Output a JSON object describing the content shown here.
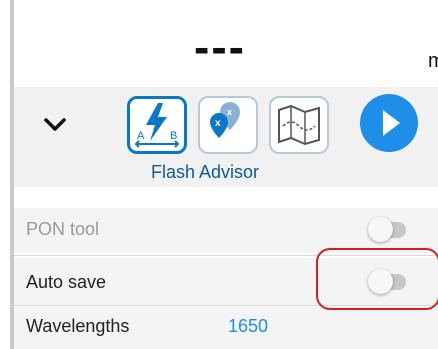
{
  "readout": {
    "value": "---",
    "unit": "m"
  },
  "toolbar": {
    "collapse_icon": "chevron-down-icon",
    "tools": [
      {
        "name": "Flash Advisor",
        "icon": "flash-advisor-icon",
        "selected": true
      },
      {
        "name": "location-icon",
        "icon": "location-icon",
        "selected": false
      },
      {
        "name": "map-icon",
        "icon": "map-icon",
        "selected": false
      }
    ],
    "selected_label": "Flash Advisor",
    "play_icon": "play-icon",
    "accent": "#1e8fe8"
  },
  "settings": {
    "pon_tool": {
      "label": "PON tool",
      "enabled": false,
      "on": false
    },
    "auto_save": {
      "label": "Auto save",
      "on": false
    },
    "wavelengths": {
      "label": "Wavelengths",
      "value": "1650"
    }
  },
  "colors": {
    "highlight": "#d42020",
    "selected_border": "#0a78c8",
    "wavelength_value": "#1e8fe8"
  }
}
